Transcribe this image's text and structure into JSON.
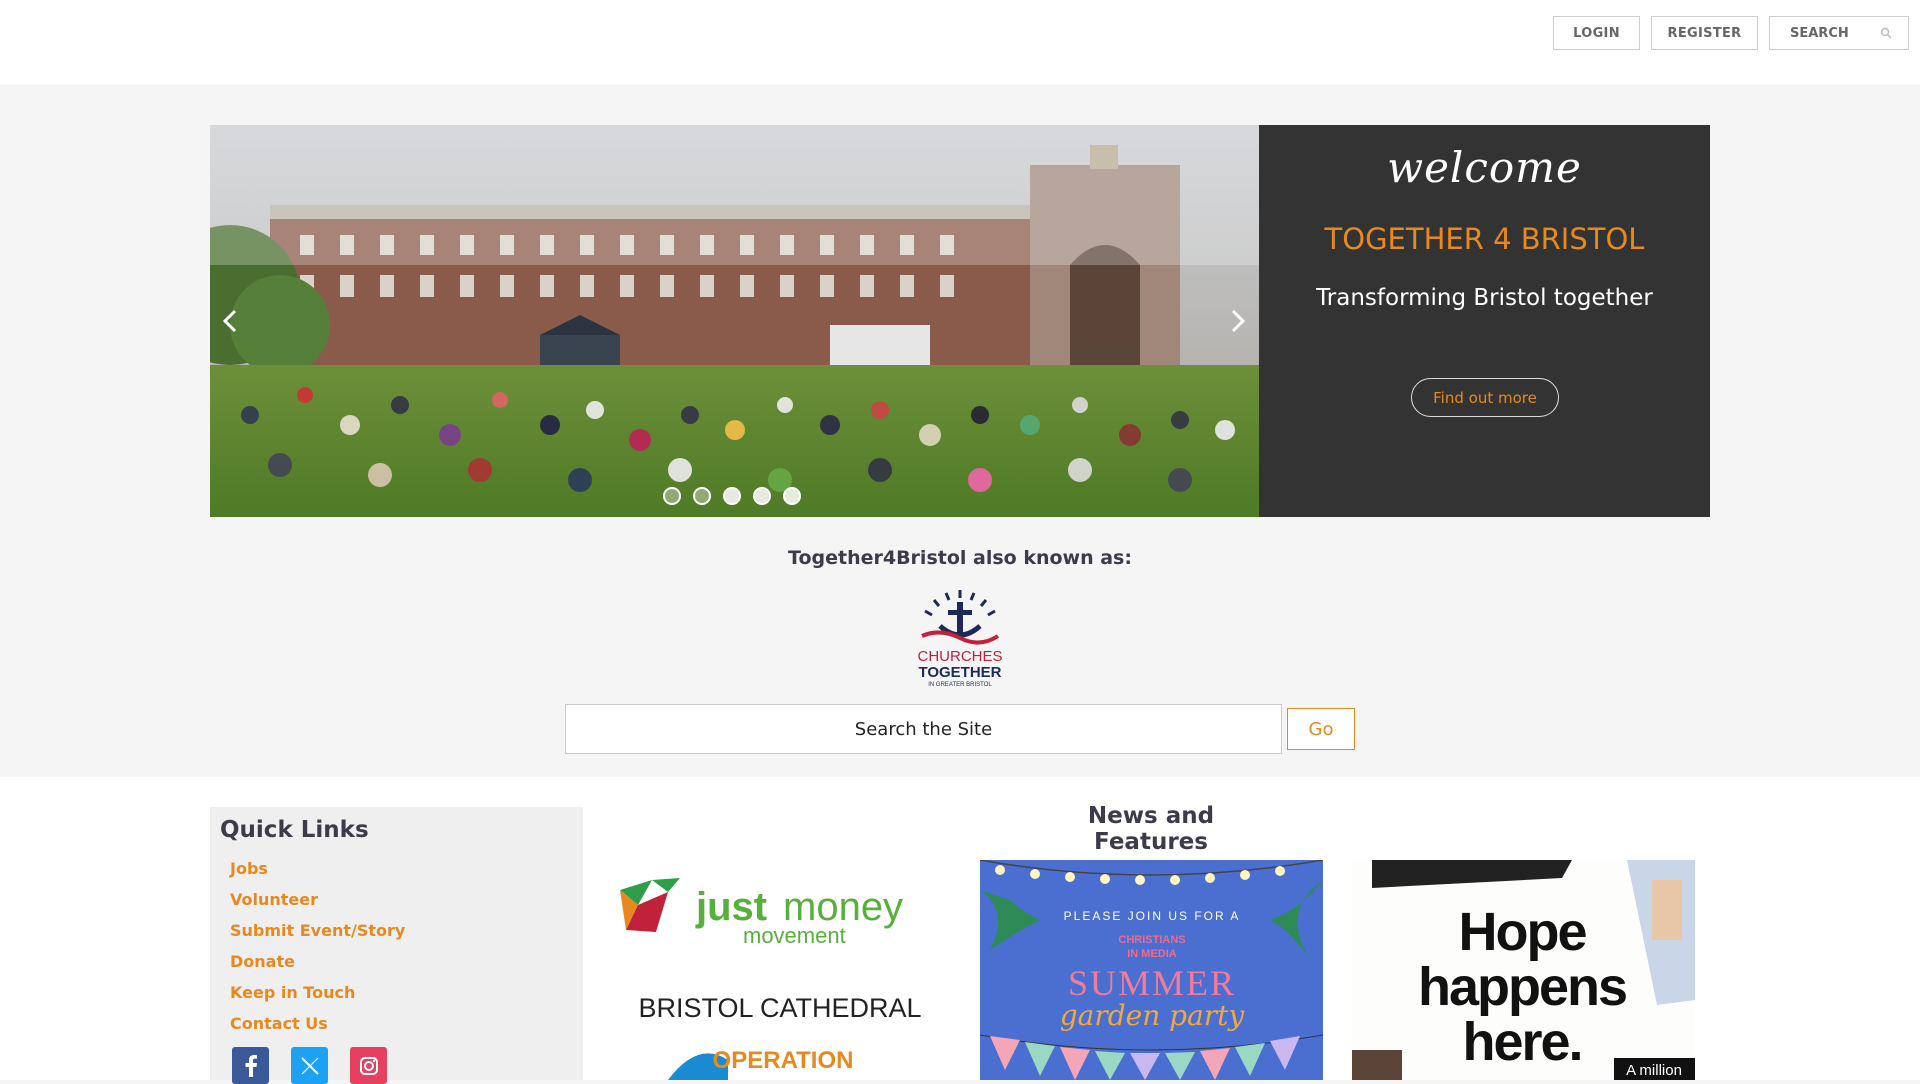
{
  "header": {
    "login_label": "LOGIN",
    "register_label": "REGISTER",
    "search_placeholder": "SEARCH"
  },
  "hero": {
    "welcome_script": "welcome",
    "title": "TOGETHER 4 BRISTOL",
    "subtitle": "Transforming Bristol together",
    "cta_label": "Find out more",
    "slides_count": 5,
    "active_slide": 3
  },
  "aka": {
    "heading": "Together4Bristol also known as:",
    "logo_line1": "CHURCHES",
    "logo_line2": "TOGETHER",
    "logo_line3": "IN GREATER BRISTOL"
  },
  "site_search": {
    "placeholder": "Search the Site",
    "go_label": "Go"
  },
  "quick_links": {
    "title": "Quick Links",
    "items": [
      "Jobs",
      "Volunteer",
      "Submit Event/Story",
      "Donate",
      "Keep in Touch",
      "Contact Us"
    ]
  },
  "news": {
    "title": "News and Features",
    "card1": {
      "brand_main": "just",
      "brand_accent": "money",
      "brand_sub": "movement",
      "line2": "BRISTOL CATHEDRAL",
      "line3": "OPERATION"
    },
    "card2": {
      "arc_text": "PLEASE JOIN US FOR A",
      "org": "CHRISTIANS",
      "org2": "IN MEDIA",
      "headline": "SUMMER",
      "subline": "garden party"
    },
    "card3": {
      "line1": "Hope",
      "line2": "happens",
      "line3": "here.",
      "badge": "A million"
    }
  },
  "colors": {
    "accent": "#e8891f",
    "dark_panel": "#333333",
    "heading": "#3b3b4a"
  }
}
